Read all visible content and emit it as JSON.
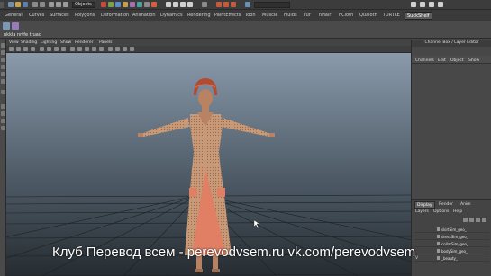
{
  "status_line": {
    "menu_set": "Objects"
  },
  "shelf_tabs": [
    {
      "label": "General",
      "active": false
    },
    {
      "label": "Curves",
      "active": false
    },
    {
      "label": "Surfaces",
      "active": false
    },
    {
      "label": "Polygons",
      "active": false
    },
    {
      "label": "Deformation",
      "active": false
    },
    {
      "label": "Animation",
      "active": false
    },
    {
      "label": "Dynamics",
      "active": false
    },
    {
      "label": "Rendering",
      "active": false
    },
    {
      "label": "PaintEffects",
      "active": false
    },
    {
      "label": "Toon",
      "active": false
    },
    {
      "label": "Muscle",
      "active": false
    },
    {
      "label": "Fluids",
      "active": false
    },
    {
      "label": "Fur",
      "active": false
    },
    {
      "label": "nHair",
      "active": false
    },
    {
      "label": "nCloth",
      "active": false
    },
    {
      "label": "Qualoth",
      "active": false
    },
    {
      "label": "TURTLE",
      "active": false
    },
    {
      "label": "SuckShelf",
      "active": true
    }
  ],
  "shelf_caption": "nkkla nrtfe truac",
  "panel_menu": [
    "View",
    "Shading",
    "Lighting",
    "Show",
    "Renderer",
    "Panels"
  ],
  "channel_box": {
    "title": "Channel Box / Layer Editor",
    "menu": [
      "Channels",
      "Edit",
      "Object",
      "Show"
    ]
  },
  "layer_editor": {
    "tabs": [
      {
        "label": "Display",
        "active": true
      },
      {
        "label": "Render",
        "active": false
      },
      {
        "label": "Anim",
        "active": false
      }
    ],
    "menu": [
      "Layers",
      "Options",
      "Help"
    ],
    "layers": [
      {
        "visible": "",
        "name": "skirtSim_geo_"
      },
      {
        "visible": "",
        "name": "dressSim_geo_"
      },
      {
        "visible": "",
        "name": "collarSim_geo_"
      },
      {
        "visible": "",
        "name": "bodySim_geo_"
      },
      {
        "visible": "V",
        "name": "_beauty_"
      }
    ]
  },
  "watermark": "Клуб Перевод всем - perevodvsem.ru  vk.com/perevodvsem",
  "colors": {
    "viewport_top": "#8a9aab",
    "viewport_bottom": "#262c31",
    "dress": "#c89a78",
    "panel_skirt": "#e07f63",
    "hat": "#b24a34",
    "skin": "#b98262",
    "active_tab": "#5c5c5c"
  }
}
